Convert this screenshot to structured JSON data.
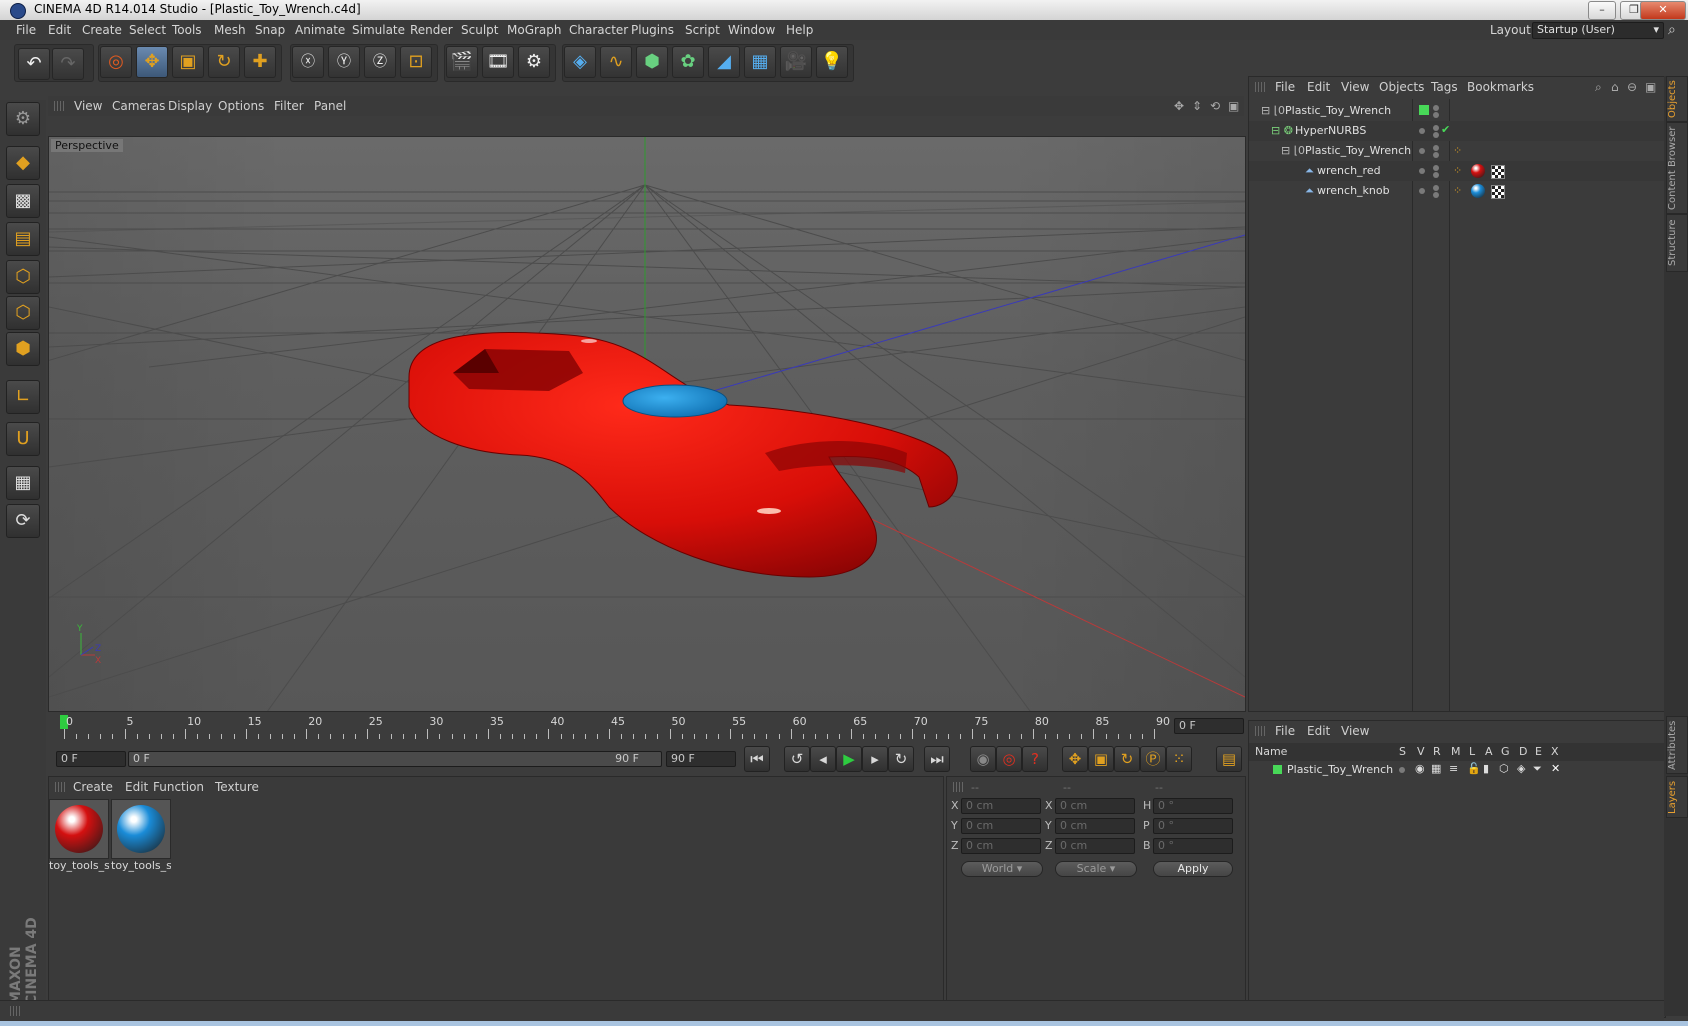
{
  "window": {
    "title": "CINEMA 4D R14.014 Studio - [Plastic_Toy_Wrench.c4d]"
  },
  "menu": [
    "File",
    "Edit",
    "Create",
    "Select",
    "Tools",
    "Mesh",
    "Snap",
    "Animate",
    "Simulate",
    "Render",
    "Sculpt",
    "MoGraph",
    "Character",
    "Plugins",
    "Script",
    "Window",
    "Help"
  ],
  "layout": {
    "label": "Layout:",
    "value": "Startup (User)"
  },
  "viewport": {
    "menu": [
      "View",
      "Cameras",
      "Display",
      "Options",
      "Filter",
      "Panel"
    ],
    "name": "Perspective"
  },
  "objects": {
    "menu": [
      "File",
      "Edit",
      "View",
      "Objects",
      "Tags",
      "Bookmarks"
    ],
    "tree": [
      {
        "name": "Plastic_Toy_Wrench",
        "indent": 0
      },
      {
        "name": "HyperNURBS",
        "indent": 1
      },
      {
        "name": "Plastic_Toy_Wrench",
        "indent": 2
      },
      {
        "name": "wrench_red",
        "indent": 3
      },
      {
        "name": "wrench_knob",
        "indent": 3
      }
    ]
  },
  "timeline": {
    "ticks": [
      "0",
      "5",
      "10",
      "15",
      "20",
      "25",
      "30",
      "35",
      "40",
      "45",
      "50",
      "55",
      "60",
      "65",
      "70",
      "75",
      "80",
      "85",
      "90"
    ],
    "current_frame": "0 F",
    "start_frame": "0 F",
    "range_start": "0 F",
    "range_end": "90 F",
    "end_frame": "90 F"
  },
  "materials": {
    "menu": [
      "Create",
      "Edit",
      "Function",
      "Texture"
    ],
    "items": [
      {
        "name": "toy_tools_s",
        "color": "#d41010"
      },
      {
        "name": "toy_tools_s",
        "color": "#1a8cd8"
      }
    ]
  },
  "coordinates": {
    "headers": [
      "--",
      "--",
      "--"
    ],
    "rows": [
      {
        "a": "X",
        "av": "0 cm",
        "b": "X",
        "bv": "0 cm",
        "c": "H",
        "cv": "0 °"
      },
      {
        "a": "Y",
        "av": "0 cm",
        "b": "Y",
        "bv": "0 cm",
        "c": "P",
        "cv": "0 °"
      },
      {
        "a": "Z",
        "av": "0 cm",
        "b": "Z",
        "bv": "0 cm",
        "c": "B",
        "cv": "0 °"
      }
    ],
    "mode": "World",
    "scale": "Scale",
    "apply": "Apply"
  },
  "layers": {
    "menu": [
      "File",
      "Edit",
      "View"
    ],
    "columns": [
      "Name",
      "S",
      "V",
      "R",
      "M",
      "L",
      "A",
      "G",
      "D",
      "E",
      "X"
    ],
    "rows": [
      {
        "name": "Plastic_Toy_Wrench"
      }
    ]
  },
  "side_tabs": [
    "Objects",
    "Content Browser",
    "Structure",
    "Attributes",
    "Layers"
  ],
  "branding": {
    "text": "MAXON CINEMA 4D"
  },
  "colors": {
    "accent": "#e0a020",
    "wrench": "#d41010",
    "knob": "#1a8cd8",
    "selection": "#4f72a0"
  }
}
